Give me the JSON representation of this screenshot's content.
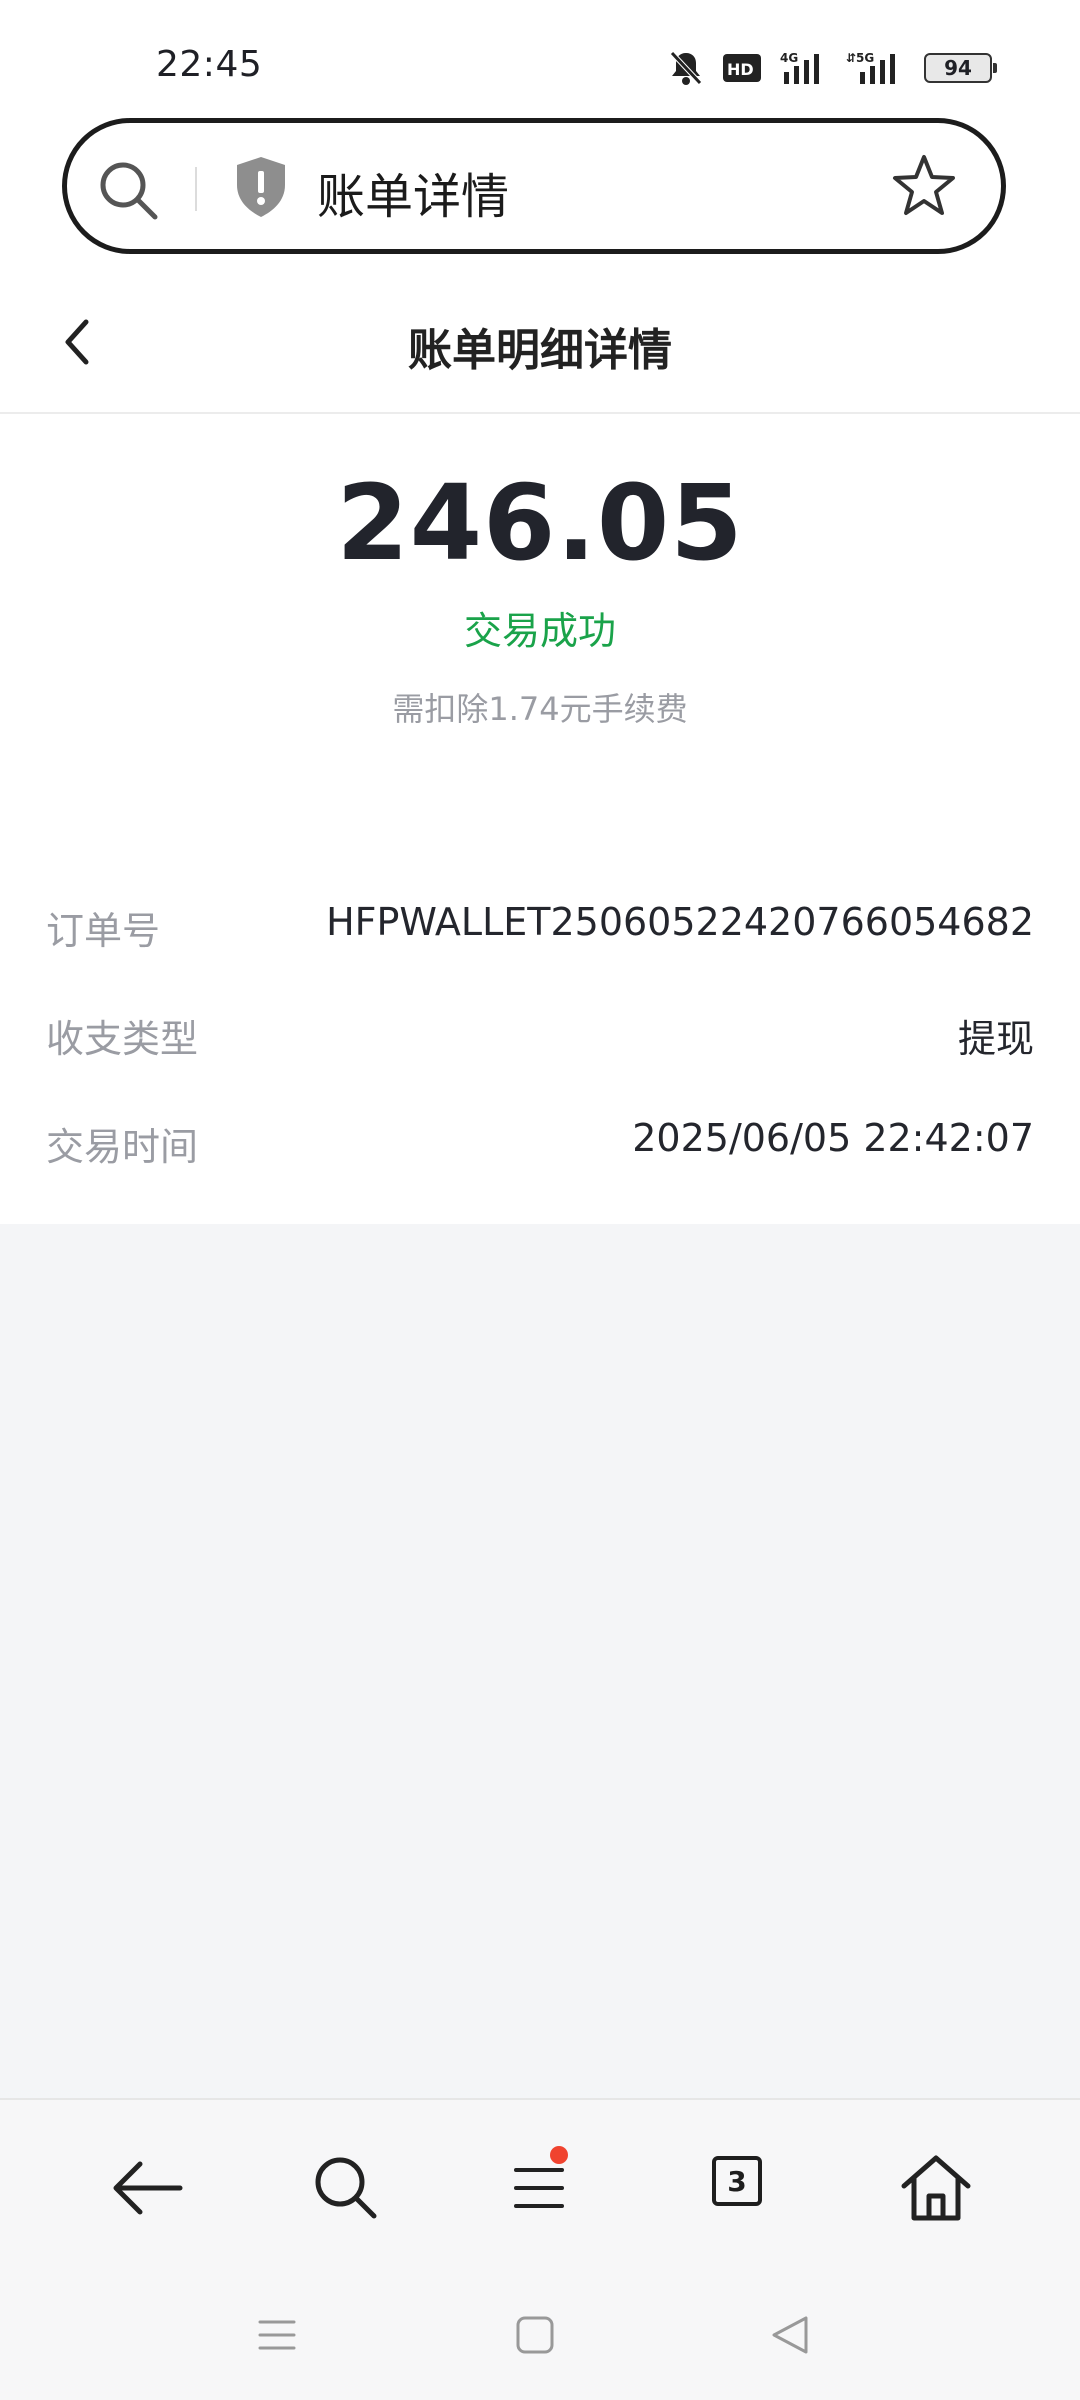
{
  "status_bar": {
    "time": "22:45",
    "icons": [
      "bell-muted-icon",
      "hd-icon",
      "4g-signal-icon",
      "5g-signal-icon"
    ],
    "battery": "94"
  },
  "address_bar": {
    "title": "账单详情"
  },
  "header": {
    "title": "账单明细详情"
  },
  "summary": {
    "amount": "246.05",
    "status": "交易成功",
    "fee_note": "需扣除1.74元手续费",
    "status_color": "#1aa34a"
  },
  "details": [
    {
      "label": "订单号",
      "value": "HFPWALLET25060522420766054682"
    },
    {
      "label": "收支类型",
      "value": "提现"
    },
    {
      "label": "交易时间",
      "value": "2025/06/05 22:42:07"
    }
  ],
  "toolbar": {
    "tab_count": "3",
    "notification_color": "#f0432f"
  }
}
